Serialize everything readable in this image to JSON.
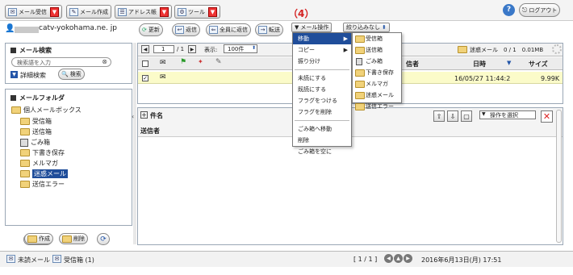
{
  "toolbar": {
    "receive": "メール受信",
    "compose": "メール作成",
    "address_book": "アドレス帳",
    "tools": "ツール",
    "help": "?",
    "logout": "ログアウト"
  },
  "annotation": "（4）",
  "account": {
    "email": "catv-yokohama.ne. jp"
  },
  "actions": {
    "refresh": "更新",
    "reply": "返信",
    "reply_all": "全員に返信",
    "forward": "転送",
    "mail_ops": "メール操作",
    "filter": "絞り込みなし"
  },
  "search": {
    "title": "メール検索",
    "placeholder": "検索語を入力",
    "advanced": "詳細検索",
    "search_button": "検索"
  },
  "folders": {
    "title": "メールフォルダ",
    "root": "個人メールボックス",
    "items": [
      "受信箱",
      "送信箱",
      "ごみ箱",
      "下書き保存",
      "メルマガ",
      "迷惑メール",
      "送信エラー"
    ],
    "create": "作成",
    "delete": "削除"
  },
  "list": {
    "page_current": "1",
    "page_total": "/ 1",
    "display_label": "表示:",
    "display_count": "100件",
    "folder_status": "迷惑メール　0 / 1　0.01MB",
    "col_sender": "信者",
    "col_date": "日時",
    "col_size": "サイズ",
    "row_date": "16/05/27 11:44:2",
    "row_size": "9.99K"
  },
  "preview": {
    "subject_label": "件名",
    "sender_label": "送信者",
    "op_select": "操作を選択"
  },
  "context_menu": {
    "items": [
      "移動",
      "コピー",
      "振り分け",
      "未読にする",
      "既読にする",
      "フラグをつける",
      "フラグを削除",
      "ごみ箱へ移動",
      "削除",
      "ごみ箱を空に"
    ]
  },
  "submenu": {
    "items": [
      "受信箱",
      "送信箱",
      "ごみ箱",
      "下書き保存",
      "メルマガ",
      "迷惑メール",
      "送信エラー"
    ]
  },
  "status": {
    "unread": "未読メール",
    "inbox": "受信箱 (1)",
    "page": "[ 1 / 1 ]",
    "datetime": "2016年6月13日(月)  17:51"
  }
}
